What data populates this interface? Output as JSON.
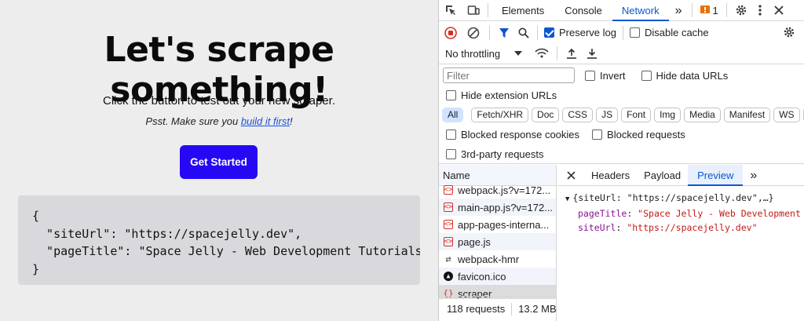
{
  "page": {
    "heading": "Let's scrape something!",
    "lead": "Click the button to test out your new scraper.",
    "psst_before": "Psst. Make sure you ",
    "psst_link": "build it first",
    "psst_after": "!",
    "cta": "Get Started",
    "code_lines": [
      "{",
      "  \"siteUrl\": \"https://spacejelly.dev\",",
      "  \"pageTitle\": \"Space Jelly - Web Development Tutorials fo",
      "}"
    ]
  },
  "devtools": {
    "tabs": [
      "Elements",
      "Console",
      "Network"
    ],
    "active_tab": "Network",
    "more_tabs": "»",
    "issues_count": "1",
    "preserve_log": "Preserve log",
    "disable_cache": "Disable cache",
    "throttling": "No throttling",
    "filter_placeholder": "Filter",
    "invert": "Invert",
    "hide_data_urls": "Hide data URLs",
    "hide_extension_urls": "Hide extension URLs",
    "types": [
      "All",
      "Fetch/XHR",
      "Doc",
      "CSS",
      "JS",
      "Font",
      "Img",
      "Media",
      "Manifest",
      "WS",
      "W"
    ],
    "blocked_cookies": "Blocked response cookies",
    "blocked_requests": "Blocked requests",
    "third_party": "3rd-party requests",
    "name_header": "Name",
    "requests": [
      {
        "name": "webpack.js?v=172...",
        "icon": "js"
      },
      {
        "name": "main-app.js?v=172...",
        "icon": "js"
      },
      {
        "name": "app-pages-interna...",
        "icon": "js"
      },
      {
        "name": "page.js",
        "icon": "js"
      },
      {
        "name": "webpack-hmr",
        "icon": "ws"
      },
      {
        "name": "favicon.ico",
        "icon": "fav"
      },
      {
        "name": "scraper",
        "icon": "json"
      }
    ],
    "footer_requests": "118 requests",
    "footer_size": "13.2 MB",
    "detail_tabs": [
      "Headers",
      "Payload",
      "Preview"
    ],
    "active_detail_tab": "Preview",
    "preview": {
      "summary": "{siteUrl: \"https://spacejelly.dev\",…}",
      "lines": [
        {
          "key": "pageTitle",
          "value": "\"Space Jelly - Web Development Tutorials for ...\""
        },
        {
          "key": "siteUrl",
          "value": "\"https://spacejelly.dev\""
        }
      ]
    },
    "colors": {
      "accent": "#0b57d0",
      "cta": "#2708f5",
      "record": "#d93025"
    }
  }
}
